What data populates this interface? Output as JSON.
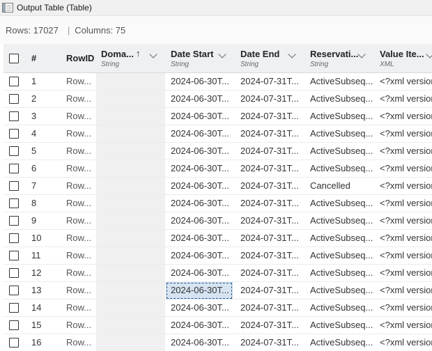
{
  "window": {
    "title": "Output Table (Table)"
  },
  "info": {
    "rows": "Rows: 17027",
    "separator": "|",
    "columns": "Columns: 75"
  },
  "columns": [
    {
      "name": "#",
      "type": ""
    },
    {
      "name": "RowID",
      "type": ""
    },
    {
      "name": "Doma...",
      "type": "String",
      "sort_icon": "↑"
    },
    {
      "name": "Date Start",
      "type": "String"
    },
    {
      "name": "Date End",
      "type": "String"
    },
    {
      "name": "Reservati...",
      "type": "String"
    },
    {
      "name": "Value Ite...",
      "type": "XML"
    }
  ],
  "rows": [
    {
      "num": "1",
      "rowid": "Row...",
      "date_start": "2024-06-30T...",
      "date_end": "2024-07-31T...",
      "reservation": "ActiveSubseq...",
      "value": "<?xml version"
    },
    {
      "num": "2",
      "rowid": "Row...",
      "date_start": "2024-06-30T...",
      "date_end": "2024-07-31T...",
      "reservation": "ActiveSubseq...",
      "value": "<?xml version"
    },
    {
      "num": "3",
      "rowid": "Row...",
      "date_start": "2024-06-30T...",
      "date_end": "2024-07-31T...",
      "reservation": "ActiveSubseq...",
      "value": "<?xml version"
    },
    {
      "num": "4",
      "rowid": "Row...",
      "date_start": "2024-06-30T...",
      "date_end": "2024-07-31T...",
      "reservation": "ActiveSubseq...",
      "value": "<?xml version"
    },
    {
      "num": "5",
      "rowid": "Row...",
      "date_start": "2024-06-30T...",
      "date_end": "2024-07-31T...",
      "reservation": "ActiveSubseq...",
      "value": "<?xml version"
    },
    {
      "num": "6",
      "rowid": "Row...",
      "date_start": "2024-06-30T...",
      "date_end": "2024-07-31T...",
      "reservation": "ActiveSubseq...",
      "value": "<?xml version"
    },
    {
      "num": "7",
      "rowid": "Row...",
      "date_start": "2024-06-30T...",
      "date_end": "2024-07-31T...",
      "reservation": "Cancelled",
      "value": "<?xml version"
    },
    {
      "num": "8",
      "rowid": "Row...",
      "date_start": "2024-06-30T...",
      "date_end": "2024-07-31T...",
      "reservation": "ActiveSubseq...",
      "value": "<?xml version"
    },
    {
      "num": "9",
      "rowid": "Row...",
      "date_start": "2024-06-30T...",
      "date_end": "2024-07-31T...",
      "reservation": "ActiveSubseq...",
      "value": "<?xml version"
    },
    {
      "num": "10",
      "rowid": "Row...",
      "date_start": "2024-06-30T...",
      "date_end": "2024-07-31T...",
      "reservation": "ActiveSubseq...",
      "value": "<?xml version"
    },
    {
      "num": "11",
      "rowid": "Row...",
      "date_start": "2024-06-30T...",
      "date_end": "2024-07-31T...",
      "reservation": "ActiveSubseq...",
      "value": "<?xml version"
    },
    {
      "num": "12",
      "rowid": "Row...",
      "date_start": "2024-06-30T...",
      "date_end": "2024-07-31T...",
      "reservation": "ActiveSubseq...",
      "value": "<?xml version"
    },
    {
      "num": "13",
      "rowid": "Row...",
      "date_start": "2024-06-30T...",
      "date_end": "2024-07-31T...",
      "reservation": "ActiveSubseq...",
      "value": "<?xml version",
      "selected": true
    },
    {
      "num": "14",
      "rowid": "Row...",
      "date_start": "2024-06-30T...",
      "date_end": "2024-07-31T...",
      "reservation": "ActiveSubseq...",
      "value": "<?xml version"
    },
    {
      "num": "15",
      "rowid": "Row...",
      "date_start": "2024-06-30T...",
      "date_end": "2024-07-31T...",
      "reservation": "ActiveSubseq...",
      "value": "<?xml version"
    },
    {
      "num": "16",
      "rowid": "Row...",
      "date_start": "2024-06-30T...",
      "date_end": "2024-07-31T...",
      "reservation": "ActiveSubseq...",
      "value": "<?xml version"
    }
  ]
}
